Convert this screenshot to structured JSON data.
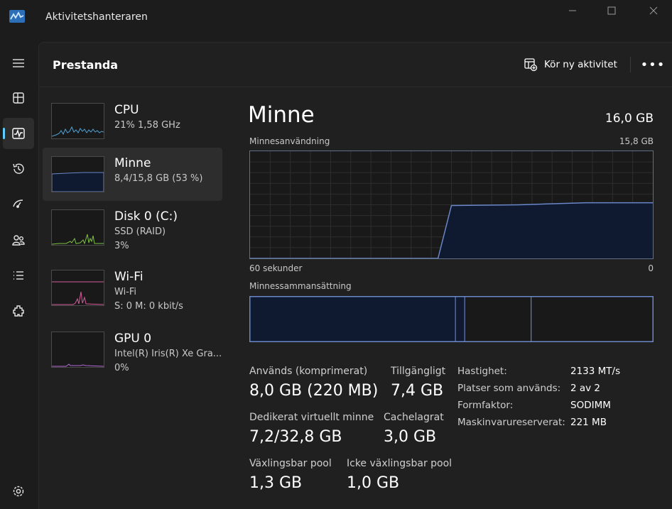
{
  "window": {
    "title": "Aktivitetshanteraren"
  },
  "header": {
    "title": "Prestanda",
    "run_task_label": "Kör ny aktivitet",
    "more_label": "•••"
  },
  "nav": [
    {
      "name": "menu-icon"
    },
    {
      "name": "processes-icon"
    },
    {
      "name": "performance-icon"
    },
    {
      "name": "app-history-icon"
    },
    {
      "name": "startup-icon"
    },
    {
      "name": "users-icon"
    },
    {
      "name": "details-icon"
    },
    {
      "name": "services-icon"
    },
    {
      "name": "settings-icon"
    }
  ],
  "devices": [
    {
      "name": "CPU",
      "line1": "21%  1,58 GHz",
      "line2": "",
      "color": "#4ea3d8"
    },
    {
      "name": "Minne",
      "line1": "8,4/15,8 GB (53 %)",
      "line2": "",
      "color": "#6a87c8"
    },
    {
      "name": "Disk 0 (C:)",
      "line1": "SSD (RAID)",
      "line2": "3%",
      "color": "#7cc242"
    },
    {
      "name": "Wi-Fi",
      "line1": "Wi-Fi",
      "line2": "S: 0 M: 0 kbit/s",
      "color": "#d85a9a"
    },
    {
      "name": "GPU 0",
      "line1": "Intel(R) Iris(R) Xe Gra...",
      "line2": "0%",
      "color": "#b36ad8"
    }
  ],
  "detail": {
    "title": "Minne",
    "total": "16,0 GB",
    "usage_label": "Minnesanvändning",
    "usage_max": "15,8 GB",
    "time_left": "60 sekunder",
    "time_right": "0",
    "composition_label": "Minnessammansättning"
  },
  "stats": {
    "in_use_label": "Används (komprimerat)",
    "in_use_value": "8,0 GB (220 MB)",
    "available_label": "Tillgängligt",
    "available_value": "7,4 GB",
    "committed_label": "Dedikerat virtuellt minne",
    "committed_value": "7,2/32,8 GB",
    "cached_label": "Cachelagrat",
    "cached_value": "3,0 GB",
    "paged_label": "Växlingsbar pool",
    "paged_value": "1,3 GB",
    "nonpaged_label": "Icke växlingsbar pool",
    "nonpaged_value": "1,0 GB"
  },
  "properties": [
    {
      "key": "Hastighet:",
      "value": "2133 MT/s"
    },
    {
      "key": "Platser som används:",
      "value": "2 av 2"
    },
    {
      "key": "Formfaktor:",
      "value": "SODIMM"
    },
    {
      "key": "Maskinvarureserverat:",
      "value": "221 MB"
    }
  ],
  "chart_data": {
    "type": "area",
    "title": "Minnesanvändning",
    "xlabel": "",
    "ylabel": "",
    "x_range": [
      "60 sekunder",
      "0"
    ],
    "ylim": [
      0,
      15.8
    ],
    "seconds_ago": [
      60,
      32,
      30,
      20,
      10,
      5,
      0
    ],
    "values_gb": [
      0,
      0,
      7.8,
      7.9,
      8.2,
      8.2,
      8.2
    ],
    "composition_percent": [
      51,
      2.3,
      16.5,
      30.2
    ],
    "colors": {
      "line": "#6a87c8",
      "fill": "#0f1930"
    }
  },
  "colors": {
    "accent": "#60cdff",
    "background": "#202020"
  }
}
